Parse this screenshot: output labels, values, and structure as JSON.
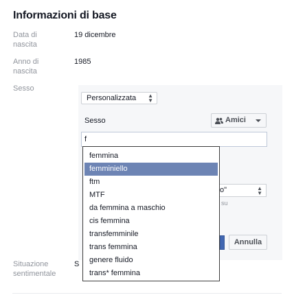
{
  "section": {
    "title": "Informazioni di base",
    "rows": [
      {
        "label_line1": "Data di",
        "label_line2": "nascita",
        "value": "19 dicembre"
      },
      {
        "label_line1": "Anno di",
        "label_line2": "nascita",
        "value": "1985"
      }
    ],
    "gender_label": "Sesso",
    "relationship_label_line1": "Situazione",
    "relationship_label_line2": "sentimentale",
    "relationship_value_partial": "S"
  },
  "editor": {
    "gender_select_value": "Personalizzata",
    "field_label": "Sesso",
    "audience_button": "Amici",
    "input_value": "f",
    "hidden_select_partial": "o\"",
    "hidden_note_partial": "su",
    "cancel_button": "Annulla"
  },
  "dropdown": {
    "items": [
      "femmina",
      "femminiello",
      "ftm",
      "MTF",
      "da femmina a maschio",
      "cis femmina",
      "transfemminile",
      "trans femmina",
      "genere fluido",
      "trans* femmina"
    ],
    "selected_index": 1
  },
  "colors": {
    "highlight": "#6d84b4",
    "primary_button": "#4267b2",
    "panel_bg": "#f6f7f9"
  }
}
